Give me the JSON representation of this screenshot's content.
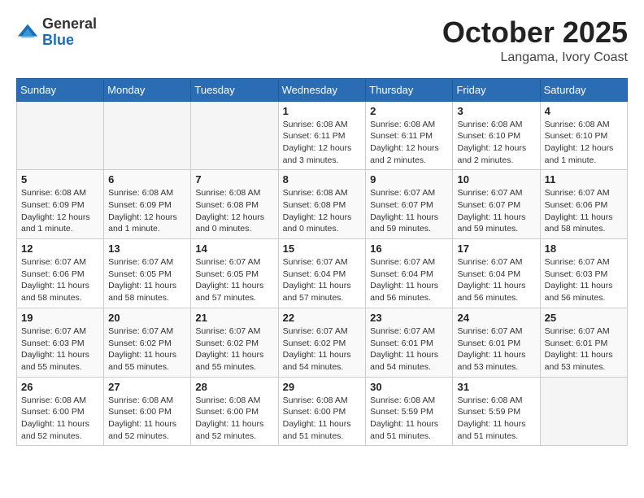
{
  "header": {
    "logo_general": "General",
    "logo_blue": "Blue",
    "month": "October 2025",
    "location": "Langama, Ivory Coast"
  },
  "weekdays": [
    "Sunday",
    "Monday",
    "Tuesday",
    "Wednesday",
    "Thursday",
    "Friday",
    "Saturday"
  ],
  "weeks": [
    [
      {
        "day": "",
        "info": ""
      },
      {
        "day": "",
        "info": ""
      },
      {
        "day": "",
        "info": ""
      },
      {
        "day": "1",
        "info": "Sunrise: 6:08 AM\nSunset: 6:11 PM\nDaylight: 12 hours and 3 minutes."
      },
      {
        "day": "2",
        "info": "Sunrise: 6:08 AM\nSunset: 6:11 PM\nDaylight: 12 hours and 2 minutes."
      },
      {
        "day": "3",
        "info": "Sunrise: 6:08 AM\nSunset: 6:10 PM\nDaylight: 12 hours and 2 minutes."
      },
      {
        "day": "4",
        "info": "Sunrise: 6:08 AM\nSunset: 6:10 PM\nDaylight: 12 hours and 1 minute."
      }
    ],
    [
      {
        "day": "5",
        "info": "Sunrise: 6:08 AM\nSunset: 6:09 PM\nDaylight: 12 hours and 1 minute."
      },
      {
        "day": "6",
        "info": "Sunrise: 6:08 AM\nSunset: 6:09 PM\nDaylight: 12 hours and 1 minute."
      },
      {
        "day": "7",
        "info": "Sunrise: 6:08 AM\nSunset: 6:08 PM\nDaylight: 12 hours and 0 minutes."
      },
      {
        "day": "8",
        "info": "Sunrise: 6:08 AM\nSunset: 6:08 PM\nDaylight: 12 hours and 0 minutes."
      },
      {
        "day": "9",
        "info": "Sunrise: 6:07 AM\nSunset: 6:07 PM\nDaylight: 11 hours and 59 minutes."
      },
      {
        "day": "10",
        "info": "Sunrise: 6:07 AM\nSunset: 6:07 PM\nDaylight: 11 hours and 59 minutes."
      },
      {
        "day": "11",
        "info": "Sunrise: 6:07 AM\nSunset: 6:06 PM\nDaylight: 11 hours and 58 minutes."
      }
    ],
    [
      {
        "day": "12",
        "info": "Sunrise: 6:07 AM\nSunset: 6:06 PM\nDaylight: 11 hours and 58 minutes."
      },
      {
        "day": "13",
        "info": "Sunrise: 6:07 AM\nSunset: 6:05 PM\nDaylight: 11 hours and 58 minutes."
      },
      {
        "day": "14",
        "info": "Sunrise: 6:07 AM\nSunset: 6:05 PM\nDaylight: 11 hours and 57 minutes."
      },
      {
        "day": "15",
        "info": "Sunrise: 6:07 AM\nSunset: 6:04 PM\nDaylight: 11 hours and 57 minutes."
      },
      {
        "day": "16",
        "info": "Sunrise: 6:07 AM\nSunset: 6:04 PM\nDaylight: 11 hours and 56 minutes."
      },
      {
        "day": "17",
        "info": "Sunrise: 6:07 AM\nSunset: 6:04 PM\nDaylight: 11 hours and 56 minutes."
      },
      {
        "day": "18",
        "info": "Sunrise: 6:07 AM\nSunset: 6:03 PM\nDaylight: 11 hours and 56 minutes."
      }
    ],
    [
      {
        "day": "19",
        "info": "Sunrise: 6:07 AM\nSunset: 6:03 PM\nDaylight: 11 hours and 55 minutes."
      },
      {
        "day": "20",
        "info": "Sunrise: 6:07 AM\nSunset: 6:02 PM\nDaylight: 11 hours and 55 minutes."
      },
      {
        "day": "21",
        "info": "Sunrise: 6:07 AM\nSunset: 6:02 PM\nDaylight: 11 hours and 55 minutes."
      },
      {
        "day": "22",
        "info": "Sunrise: 6:07 AM\nSunset: 6:02 PM\nDaylight: 11 hours and 54 minutes."
      },
      {
        "day": "23",
        "info": "Sunrise: 6:07 AM\nSunset: 6:01 PM\nDaylight: 11 hours and 54 minutes."
      },
      {
        "day": "24",
        "info": "Sunrise: 6:07 AM\nSunset: 6:01 PM\nDaylight: 11 hours and 53 minutes."
      },
      {
        "day": "25",
        "info": "Sunrise: 6:07 AM\nSunset: 6:01 PM\nDaylight: 11 hours and 53 minutes."
      }
    ],
    [
      {
        "day": "26",
        "info": "Sunrise: 6:08 AM\nSunset: 6:00 PM\nDaylight: 11 hours and 52 minutes."
      },
      {
        "day": "27",
        "info": "Sunrise: 6:08 AM\nSunset: 6:00 PM\nDaylight: 11 hours and 52 minutes."
      },
      {
        "day": "28",
        "info": "Sunrise: 6:08 AM\nSunset: 6:00 PM\nDaylight: 11 hours and 52 minutes."
      },
      {
        "day": "29",
        "info": "Sunrise: 6:08 AM\nSunset: 6:00 PM\nDaylight: 11 hours and 51 minutes."
      },
      {
        "day": "30",
        "info": "Sunrise: 6:08 AM\nSunset: 5:59 PM\nDaylight: 11 hours and 51 minutes."
      },
      {
        "day": "31",
        "info": "Sunrise: 6:08 AM\nSunset: 5:59 PM\nDaylight: 11 hours and 51 minutes."
      },
      {
        "day": "",
        "info": ""
      }
    ]
  ]
}
